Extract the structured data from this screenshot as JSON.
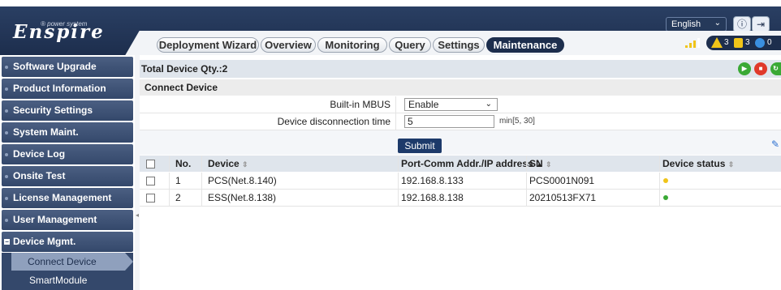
{
  "header": {
    "logo_text": "Enspire",
    "logo_tagline": "® power system",
    "language": "English",
    "alarms": {
      "major": "3",
      "minor": "3",
      "warning": "0"
    }
  },
  "tabs": [
    {
      "label": "Deployment Wizard"
    },
    {
      "label": "Overview"
    },
    {
      "label": "Monitoring"
    },
    {
      "label": "Query"
    },
    {
      "label": "Settings"
    },
    {
      "label": "Maintenance",
      "active": true
    }
  ],
  "sidebar": {
    "items": [
      {
        "label": "Software Upgrade"
      },
      {
        "label": "Product Information"
      },
      {
        "label": "Security Settings"
      },
      {
        "label": "System Maint."
      },
      {
        "label": "Device Log"
      },
      {
        "label": "Onsite Test"
      },
      {
        "label": "License Management"
      },
      {
        "label": "User Management"
      },
      {
        "label": "Device Mgmt.",
        "expanded": true
      }
    ],
    "subitems": [
      {
        "label": "Connect Device",
        "active": true
      },
      {
        "label": "SmartModule"
      }
    ]
  },
  "toolbar": {
    "total_label": "Total Device Qty.:2"
  },
  "section": {
    "title": "Connect Device"
  },
  "form": {
    "mbus_label": "Built-in MBUS",
    "mbus_value": "Enable",
    "disconnect_label": "Device disconnection time",
    "disconnect_value": "5",
    "disconnect_range": "min[5, 30]",
    "submit_label": "Submit"
  },
  "table": {
    "headers": {
      "no": "No.",
      "device": "Device",
      "address": "Port-Comm Addr./IP address",
      "sn": "SN",
      "status": "Device status"
    },
    "rows": [
      {
        "no": "1",
        "device": "PCS(Net.8.140)",
        "address": "192.168.8.133",
        "sn": "PCS0001N091",
        "status_color": "#f0c419"
      },
      {
        "no": "2",
        "device": "ESS(Net.8.138)",
        "address": "192.168.8.138",
        "sn": "20210513FX71",
        "status_color": "#3aa935"
      }
    ]
  },
  "colors": {
    "brand": "#1d2e4d",
    "accent": "#1d3a6a"
  }
}
